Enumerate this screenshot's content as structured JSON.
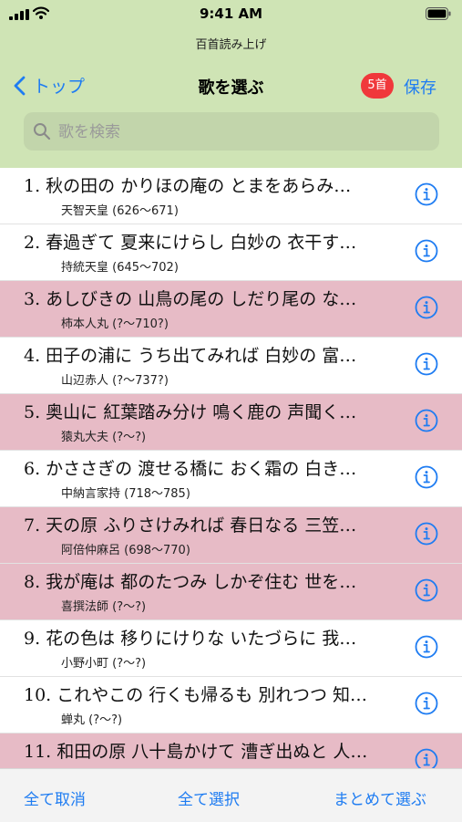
{
  "status_bar": {
    "time": "9:41 AM"
  },
  "app_title": "百首読み上げ",
  "nav": {
    "back_label": "トップ",
    "title": "歌を選ぶ",
    "count_badge": "5首",
    "save_label": "保存"
  },
  "search": {
    "placeholder": "歌を検索"
  },
  "poems": [
    {
      "text": "1. 秋の田の かりほの庵の とまをあらみ…",
      "author": "天智天皇 (626～671)",
      "selected": false
    },
    {
      "text": "2. 春過ぎて 夏来にけらし 白妙の 衣干す…",
      "author": "持統天皇 (645～702)",
      "selected": false
    },
    {
      "text": "3. あしびきの 山鳥の尾の しだり尾の な…",
      "author": "柿本人丸 (?～710?)",
      "selected": true
    },
    {
      "text": "4. 田子の浦に うち出てみれば 白妙の 富…",
      "author": "山辺赤人 (?～737?)",
      "selected": false
    },
    {
      "text": "5. 奥山に 紅葉踏み分け 鳴く鹿の 声聞く…",
      "author": "猿丸大夫 (?～?)",
      "selected": true
    },
    {
      "text": "6. かささぎの 渡せる橋に おく霜の 白き…",
      "author": "中納言家持 (718～785)",
      "selected": false
    },
    {
      "text": "7. 天の原 ふりさけみれば 春日なる 三笠…",
      "author": "阿倍仲麻呂 (698～770)",
      "selected": true
    },
    {
      "text": "8. 我が庵は 都のたつみ しかぞ住む 世を…",
      "author": "喜撰法師 (?～?)",
      "selected": true
    },
    {
      "text": "9. 花の色は 移りにけりな いたづらに 我…",
      "author": "小野小町 (?～?)",
      "selected": false
    },
    {
      "text": "10. これやこの 行くも帰るも 別れつつ 知…",
      "author": "蝉丸 (?～?)",
      "selected": false
    },
    {
      "text": "11. 和田の原 八十島かけて 漕ぎ出ぬと 人…",
      "author": "",
      "selected": true
    }
  ],
  "toolbar": {
    "clear_all": "全て取消",
    "select_all": "全て選択",
    "batch_select": "まとめて選ぶ"
  },
  "colors": {
    "header_bg": "#cfe4b5",
    "selected_row": "#e7bbc6",
    "accent": "#1e7cf2",
    "badge": "#f0383b"
  },
  "icons": [
    "signal-icon",
    "wifi-icon",
    "battery-icon",
    "chevron-left-icon",
    "search-icon",
    "info-icon"
  ]
}
